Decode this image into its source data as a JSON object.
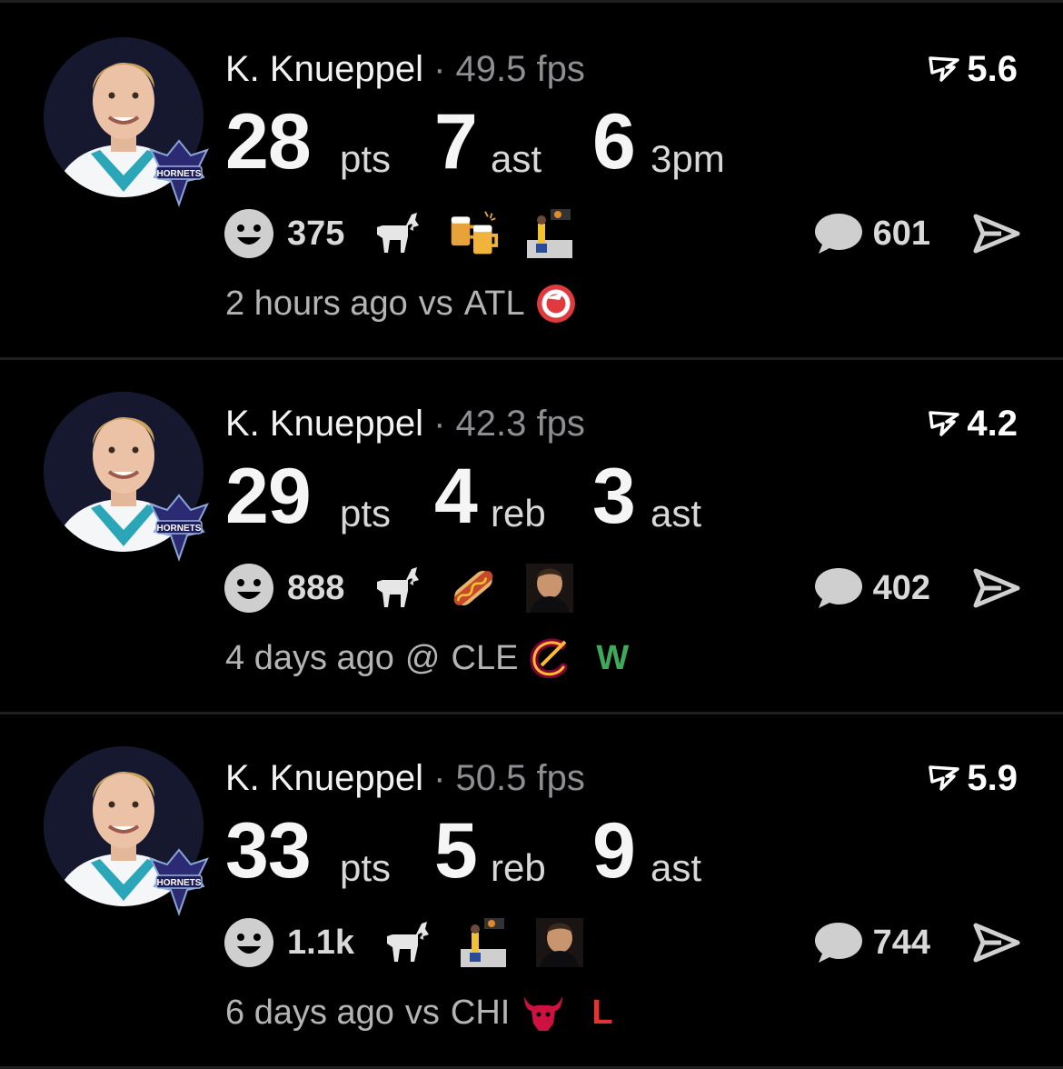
{
  "colors": {
    "background": "#000000",
    "secondary_text": "#8e8e93",
    "win": "#3fa95a",
    "loss": "#e3342f",
    "icon_gray": "#cfcfcf"
  },
  "cards": [
    {
      "player": "K. Knueppel",
      "separator": "·",
      "fps": "49.5 fps",
      "rating": "5.6",
      "stats": [
        {
          "value": "28",
          "unit": "pts"
        },
        {
          "value": "7",
          "unit": "ast"
        },
        {
          "value": "6",
          "unit": "3pm"
        }
      ],
      "reaction_count": "375",
      "reaction_icons": [
        "goat-icon",
        "beer-mugs-icon",
        "shooter-image-icon"
      ],
      "comment_count": "601",
      "footer": {
        "when": "2 hours ago",
        "location": "vs",
        "opponent": "ATL",
        "opponent_logo": "hawks-logo-icon",
        "result": ""
      }
    },
    {
      "player": "K. Knueppel",
      "separator": "·",
      "fps": "42.3 fps",
      "rating": "4.2",
      "stats": [
        {
          "value": "29",
          "unit": "pts"
        },
        {
          "value": "4",
          "unit": "reb"
        },
        {
          "value": "3",
          "unit": "ast"
        }
      ],
      "reaction_count": "888",
      "reaction_icons": [
        "goat-icon",
        "hotdog-icon",
        "player-photo-icon"
      ],
      "comment_count": "402",
      "footer": {
        "when": "4 days ago",
        "location": "@",
        "opponent": "CLE",
        "opponent_logo": "cavaliers-logo-icon",
        "result": "W"
      }
    },
    {
      "player": "K. Knueppel",
      "separator": "·",
      "fps": "50.5 fps",
      "rating": "5.9",
      "stats": [
        {
          "value": "33",
          "unit": "pts"
        },
        {
          "value": "5",
          "unit": "reb"
        },
        {
          "value": "9",
          "unit": "ast"
        }
      ],
      "reaction_count": "1.1k",
      "reaction_icons": [
        "goat-icon",
        "shooter-image-icon",
        "player-photo-icon"
      ],
      "comment_count": "744",
      "footer": {
        "when": "6 days ago",
        "location": "vs",
        "opponent": "CHI",
        "opponent_logo": "bulls-logo-icon",
        "result": "L"
      }
    }
  ]
}
